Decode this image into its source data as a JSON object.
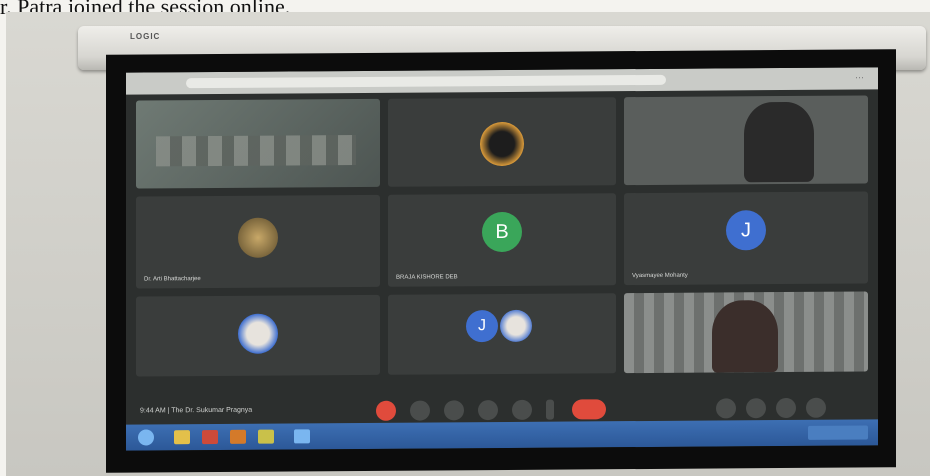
{
  "caption": "r. Patra joined the session online.",
  "projector": {
    "brand": "LOGIC"
  },
  "meeting": {
    "participants": [
      {
        "name": "",
        "type": "video-room"
      },
      {
        "name": "",
        "type": "video-silhouette"
      },
      {
        "name": "",
        "type": "video-person"
      },
      {
        "name": "Dr. Arti Bhattacharjee",
        "type": "image-avatar"
      },
      {
        "name": "BRAJA KISHORE DEB",
        "type": "letter",
        "initial": "B",
        "color": "#3aa65a"
      },
      {
        "name": "Vyasmayee Mohanty",
        "type": "letter",
        "initial": "J",
        "color": "#3f6fd0"
      },
      {
        "name": "",
        "type": "photo-avatar"
      },
      {
        "name": "",
        "type": "letter-group",
        "initial": "J",
        "color": "#3f6fd0"
      },
      {
        "name": "",
        "type": "video-woman"
      }
    ],
    "toolbar": {
      "time": "9:44 AM | The Dr. Sukumar Pragnya",
      "end_call_color": "#e04b3c"
    }
  },
  "taskbar": {
    "accent": "#2c5898"
  }
}
